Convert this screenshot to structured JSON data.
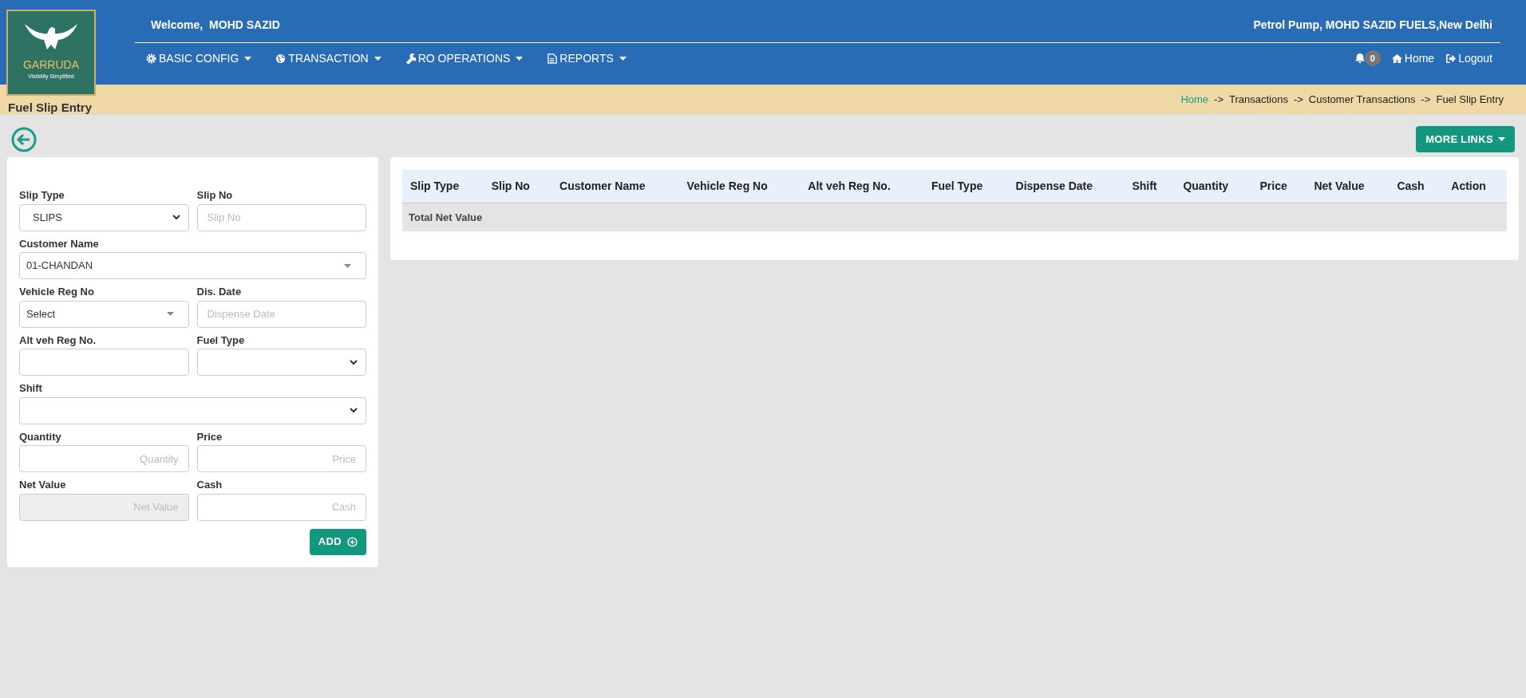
{
  "header": {
    "welcome": "Welcome,",
    "user": "MOHD SAZID",
    "station": "Petrol Pump, MOHD SAZID FUELS,New Delhi",
    "logo": {
      "name": "GARRUDA",
      "tagline": "Visibility Simplified"
    },
    "menu": [
      {
        "label": "BASIC CONFIG"
      },
      {
        "label": "TRANSACTION"
      },
      {
        "label": "RO OPERATIONS"
      },
      {
        "label": "REPORTS"
      }
    ],
    "notifications": "0",
    "links": [
      {
        "label": "Home"
      },
      {
        "label": "Logout"
      }
    ]
  },
  "page_title": "Fuel Slip Entry",
  "breadcrumb": [
    {
      "label": "Home",
      "link": true
    },
    {
      "label": "->",
      "link": false
    },
    {
      "label": "Transactions",
      "link": false
    },
    {
      "label": "->",
      "link": false
    },
    {
      "label": "Customer Transactions",
      "link": false
    },
    {
      "label": "->",
      "link": false
    },
    {
      "label": "Fuel Slip Entry",
      "link": false
    }
  ],
  "more_links": "MORE LINKS",
  "form": {
    "rows": [
      [
        {
          "label": "Slip Type",
          "kind": "select",
          "value": "SLIPS"
        },
        {
          "label": "Slip No",
          "kind": "input",
          "placeholder": "Slip No"
        }
      ],
      [
        {
          "label": "Customer Name",
          "kind": "combo",
          "value": "01-CHANDAN"
        }
      ],
      [
        {
          "label": "Vehicle Reg No",
          "kind": "combo",
          "value": "Select"
        },
        {
          "label": "Dis. Date",
          "kind": "input",
          "placeholder": "Dispense Date"
        }
      ],
      [
        {
          "label": "Alt veh Reg No.",
          "kind": "input"
        },
        {
          "label": "Fuel Type",
          "kind": "select"
        }
      ],
      [
        {
          "label": "Shift",
          "kind": "select"
        }
      ],
      [
        {
          "label": "Quantity",
          "kind": "number",
          "placeholder": "Quantity"
        },
        {
          "label": "Price",
          "kind": "number",
          "placeholder": "Price"
        }
      ],
      [
        {
          "label": "Net Value",
          "kind": "number",
          "placeholder": "Net Value",
          "disabled": true
        },
        {
          "label": "Cash",
          "kind": "number",
          "placeholder": "Cash",
          "disabled": false
        }
      ]
    ],
    "add_button": "ADD"
  },
  "table": {
    "columns": [
      "Slip Type",
      "Slip No",
      "Customer Name",
      "Vehicle Reg No",
      "Alt veh Reg No.",
      "Fuel Type",
      "Dispense Date",
      "Shift",
      "Quantity",
      "Price",
      "Net Value",
      "Cash",
      "Action"
    ],
    "total_label": "Total Net Value"
  }
}
